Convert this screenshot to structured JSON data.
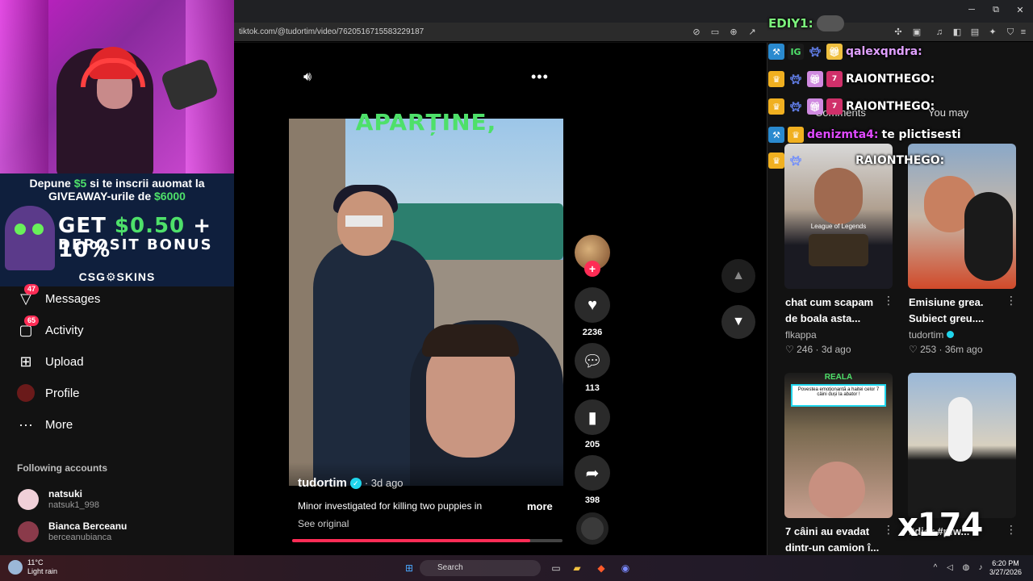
{
  "browser": {
    "url": "tiktok.com/@tudortim/video/7620516715583229187",
    "window_min": "─",
    "window_max": "⧉",
    "window_close": "✕"
  },
  "stream": {
    "ad_line1_pre": "Depune ",
    "ad_line1_amount": "$5",
    "ad_line1_post": " si te inscrii auomat la",
    "ad_line2_pre": "GIVEAWAY-urile de ",
    "ad_line2_amount": "$6000",
    "ad_big1_pre": "GET ",
    "ad_big1_amount": "$0.50",
    "ad_big1_post": " + 10%",
    "ad_big2": "DEPOSIT BONUS",
    "ad_brand": "CSG⚙SKINS",
    "multiplier": "x174"
  },
  "nav": {
    "items": [
      {
        "label": "Messages",
        "badge": "47",
        "icon": "paper-plane-icon"
      },
      {
        "label": "Activity",
        "badge": "65",
        "icon": "inbox-icon"
      },
      {
        "label": "Upload",
        "badge": "",
        "icon": "plus-square-icon"
      },
      {
        "label": "Profile",
        "badge": "",
        "icon": "avatar-icon"
      },
      {
        "label": "More",
        "badge": "",
        "icon": "ellipsis-icon"
      }
    ],
    "following_title": "Following accounts",
    "accounts": [
      {
        "name": "natsuki",
        "handle": "natsuk1_998"
      },
      {
        "name": "Bianca Berceanu",
        "handle": "berceanubianca"
      }
    ]
  },
  "video": {
    "caption_top": "APARȚINE,",
    "author": "tudortim",
    "date": "· 3d ago",
    "description": "Minor investigated for killing two puppies in",
    "more": "more",
    "see_original": "See original",
    "progress": 0.88,
    "likes": "2236",
    "comments": "113",
    "saves": "205",
    "shares": "398"
  },
  "right": {
    "you_may": "You may",
    "comments": "Comments",
    "cards": [
      {
        "title": "chat cum scapam de boala asta...",
        "author": "flkappa",
        "likes": "246",
        "age": "3d ago",
        "verified": false
      },
      {
        "title": "Emisiune grea. Subiect greu....",
        "author": "tudortim",
        "likes": "253",
        "age": "36m ago",
        "verified": true
      },
      {
        "title": "7 câini au evadat dintr-un camion î...",
        "author": "",
        "likes": "",
        "age": "",
        "verified": false
      },
      {
        "title": "#dior #pfw...",
        "author": "",
        "likes": "",
        "age": "",
        "verified": false
      }
    ],
    "thumb_label_1": "League of Legends",
    "thumb_label_3_head": "REALA",
    "thumb_label_3_body": "Povestea emoționantă a haitei celor 7 câini duși la abator !"
  },
  "chat": [
    {
      "user": "EDIY1:",
      "msg": ""
    },
    {
      "user": "qalexqndra:",
      "msg": ""
    },
    {
      "user": "RAIONTHEGO:",
      "msg": ""
    },
    {
      "user": "RAIONTHEGO:",
      "msg": ""
    },
    {
      "user": "denizmta4:",
      "msg": "te plictisesti"
    },
    {
      "user": "RAIONTHEGO:",
      "msg": ""
    }
  ],
  "taskbar": {
    "temp": "11°C",
    "weather": "Light rain",
    "search": "Search",
    "time": "6:20 PM",
    "date": "3/27/2026"
  },
  "colors": {
    "accent": "#fe2c55",
    "green": "#4ee06a",
    "verified": "#20d5ec"
  }
}
